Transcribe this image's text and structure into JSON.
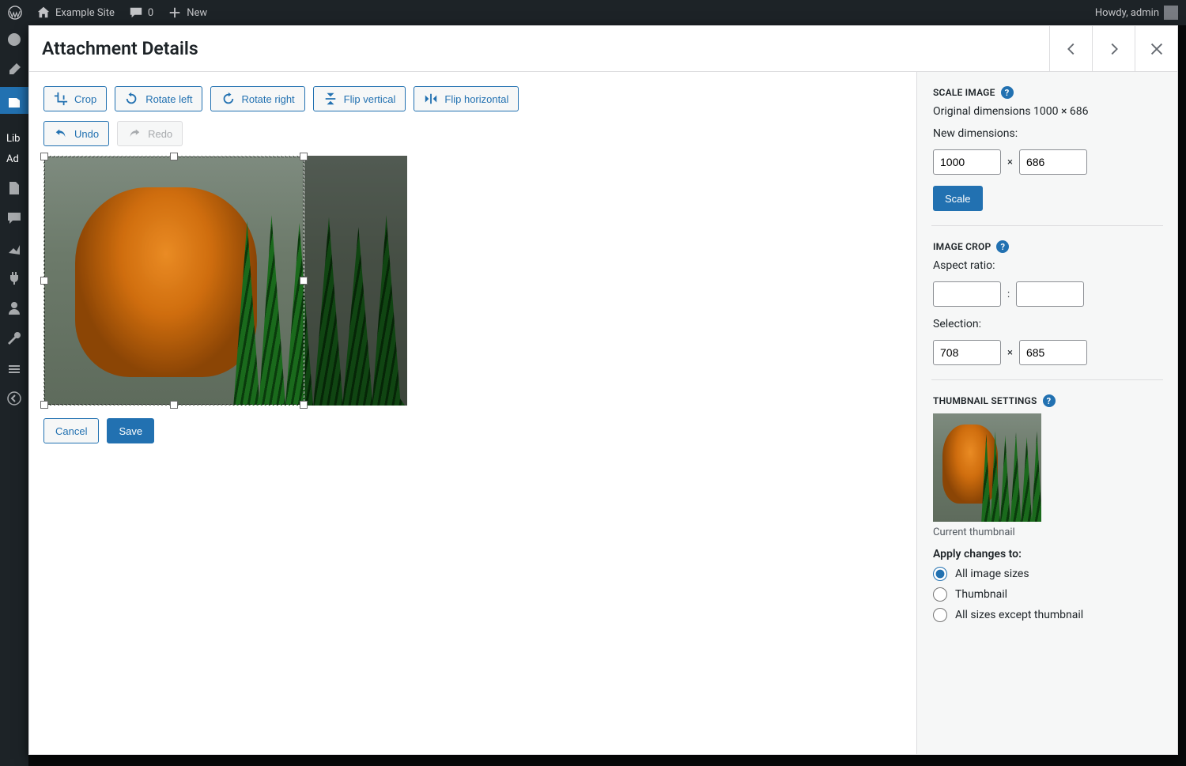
{
  "adminbar": {
    "site_name": "Example Site",
    "comments_count": "0",
    "new_label": "New",
    "howdy": "Howdy, admin"
  },
  "adminmenu": {
    "submenu": {
      "library": "Lib",
      "add_new": "Ad"
    }
  },
  "modal": {
    "title": "Attachment Details",
    "toolbar": {
      "crop": "Crop",
      "rotate_left": "Rotate left",
      "rotate_right": "Rotate right",
      "flip_vertical": "Flip vertical",
      "flip_horizontal": "Flip horizontal",
      "undo": "Undo",
      "redo": "Redo"
    },
    "actions": {
      "cancel": "Cancel",
      "save": "Save"
    }
  },
  "scale": {
    "title": "SCALE IMAGE",
    "original_label": "Original dimensions 1000 × 686",
    "new_label": "New dimensions:",
    "width": "1000",
    "height": "686",
    "times": "×",
    "button": "Scale"
  },
  "crop": {
    "title": "IMAGE CROP",
    "aspect_label": "Aspect ratio:",
    "aspect_w": "",
    "aspect_h": "",
    "colon": ":",
    "selection_label": "Selection:",
    "sel_w": "708",
    "sel_h": "685",
    "times": "×"
  },
  "thumb": {
    "title": "THUMBNAIL SETTINGS",
    "current": "Current thumbnail",
    "apply_label": "Apply changes to:",
    "opt_all": "All image sizes",
    "opt_thumb": "Thumbnail",
    "opt_except": "All sizes except thumbnail"
  }
}
